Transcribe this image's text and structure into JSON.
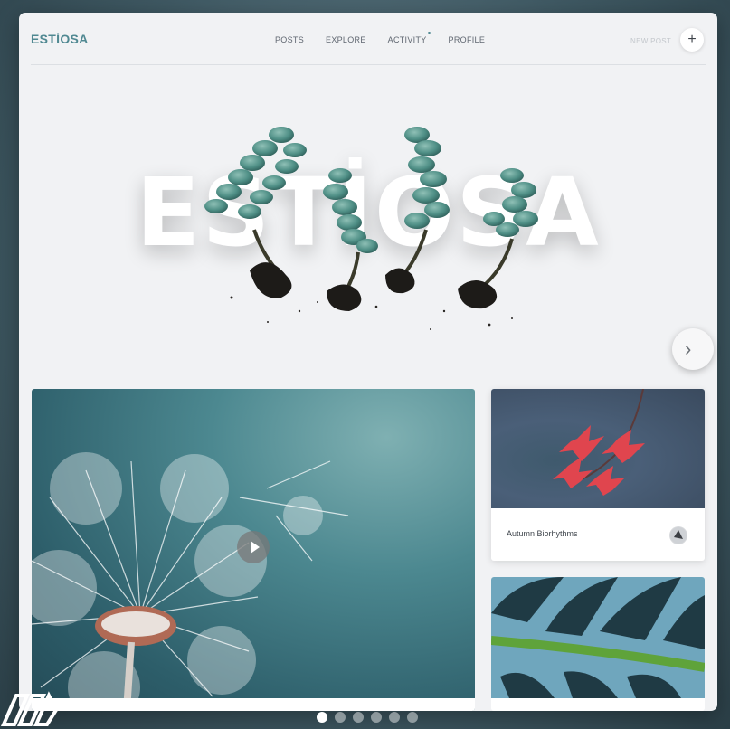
{
  "header": {
    "logo": "ESTİOSA",
    "nav": [
      "POSTS",
      "EXPLORE",
      "ACTIVITY",
      "PROFILE"
    ],
    "new_post": "NEW POST",
    "plus_icon": "+"
  },
  "hero": {
    "word": "ESTİOSA"
  },
  "cards": {
    "featured_post": {
      "play_icon": "play-icon"
    },
    "post_1": {
      "title": "Autumn Biorhythms"
    }
  },
  "carousel": {
    "next_icon": "chevron-right-icon",
    "pages": 6,
    "active_page": 1
  },
  "colors": {
    "accent": "#4f8891",
    "background": "#f1f2f4",
    "frame": "#3f5963"
  }
}
